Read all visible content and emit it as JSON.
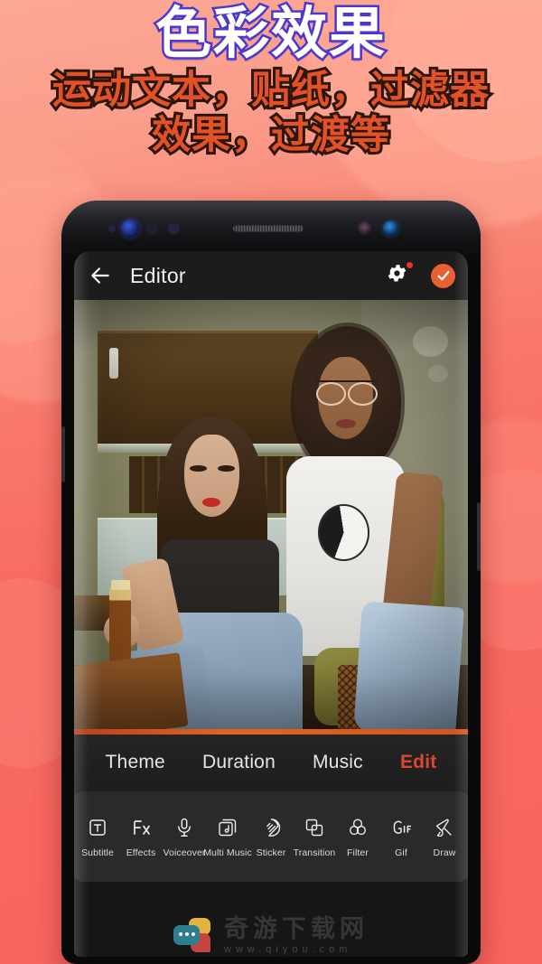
{
  "promo": {
    "title": "色彩效果",
    "subtitle_line1": "运动文本，贴纸，过滤器",
    "subtitle_line2": "效果，过渡等",
    "bg_color": "#f76a60",
    "title_fill": "#ffffff",
    "title_outline": "#4a38d0",
    "subtitle_fill": "#e35126",
    "subtitle_outline": "#2b160d"
  },
  "app": {
    "appbar": {
      "back_icon": "arrow-left-icon",
      "title": "Editor",
      "settings_icon": "gear-icon",
      "settings_badge": "•",
      "confirm_icon": "check-icon",
      "accent_color": "#e8602e",
      "badge_color": "#e8342a"
    },
    "toolbar": {
      "items": [
        {
          "label": "Subtitle",
          "icon": "text-box-icon"
        },
        {
          "label": "Effects",
          "icon": "fx-icon"
        },
        {
          "label": "Voiceover",
          "icon": "microphone-icon"
        },
        {
          "label": "Multi Music",
          "icon": "music-stack-icon"
        },
        {
          "label": "Sticker",
          "icon": "sticker-icon"
        },
        {
          "label": "Transition",
          "icon": "transition-squares-icon"
        },
        {
          "label": "Filter",
          "icon": "filter-circles-icon"
        },
        {
          "label": "Gif",
          "icon": "gif-icon"
        },
        {
          "label": "Draw",
          "icon": "brush-icon"
        }
      ]
    },
    "tabs": {
      "items": [
        {
          "label": "Theme",
          "active": false
        },
        {
          "label": "Duration",
          "active": false
        },
        {
          "label": "Music",
          "active": false
        },
        {
          "label": "Edit",
          "active": true
        }
      ],
      "active_color": "#d9472f",
      "underline_color": "#e2571f"
    },
    "bottom_strip": {
      "icons": [
        "text-box-icon",
        "crop-icon",
        "microphone-icon",
        "multi-image-icon",
        "speed-icon",
        "volume-icon"
      ]
    }
  },
  "watermark": {
    "text_cn": "奇游下载网",
    "text_url": "www.qiyou.com",
    "logo_icon": "chat-bubbles-icon"
  }
}
